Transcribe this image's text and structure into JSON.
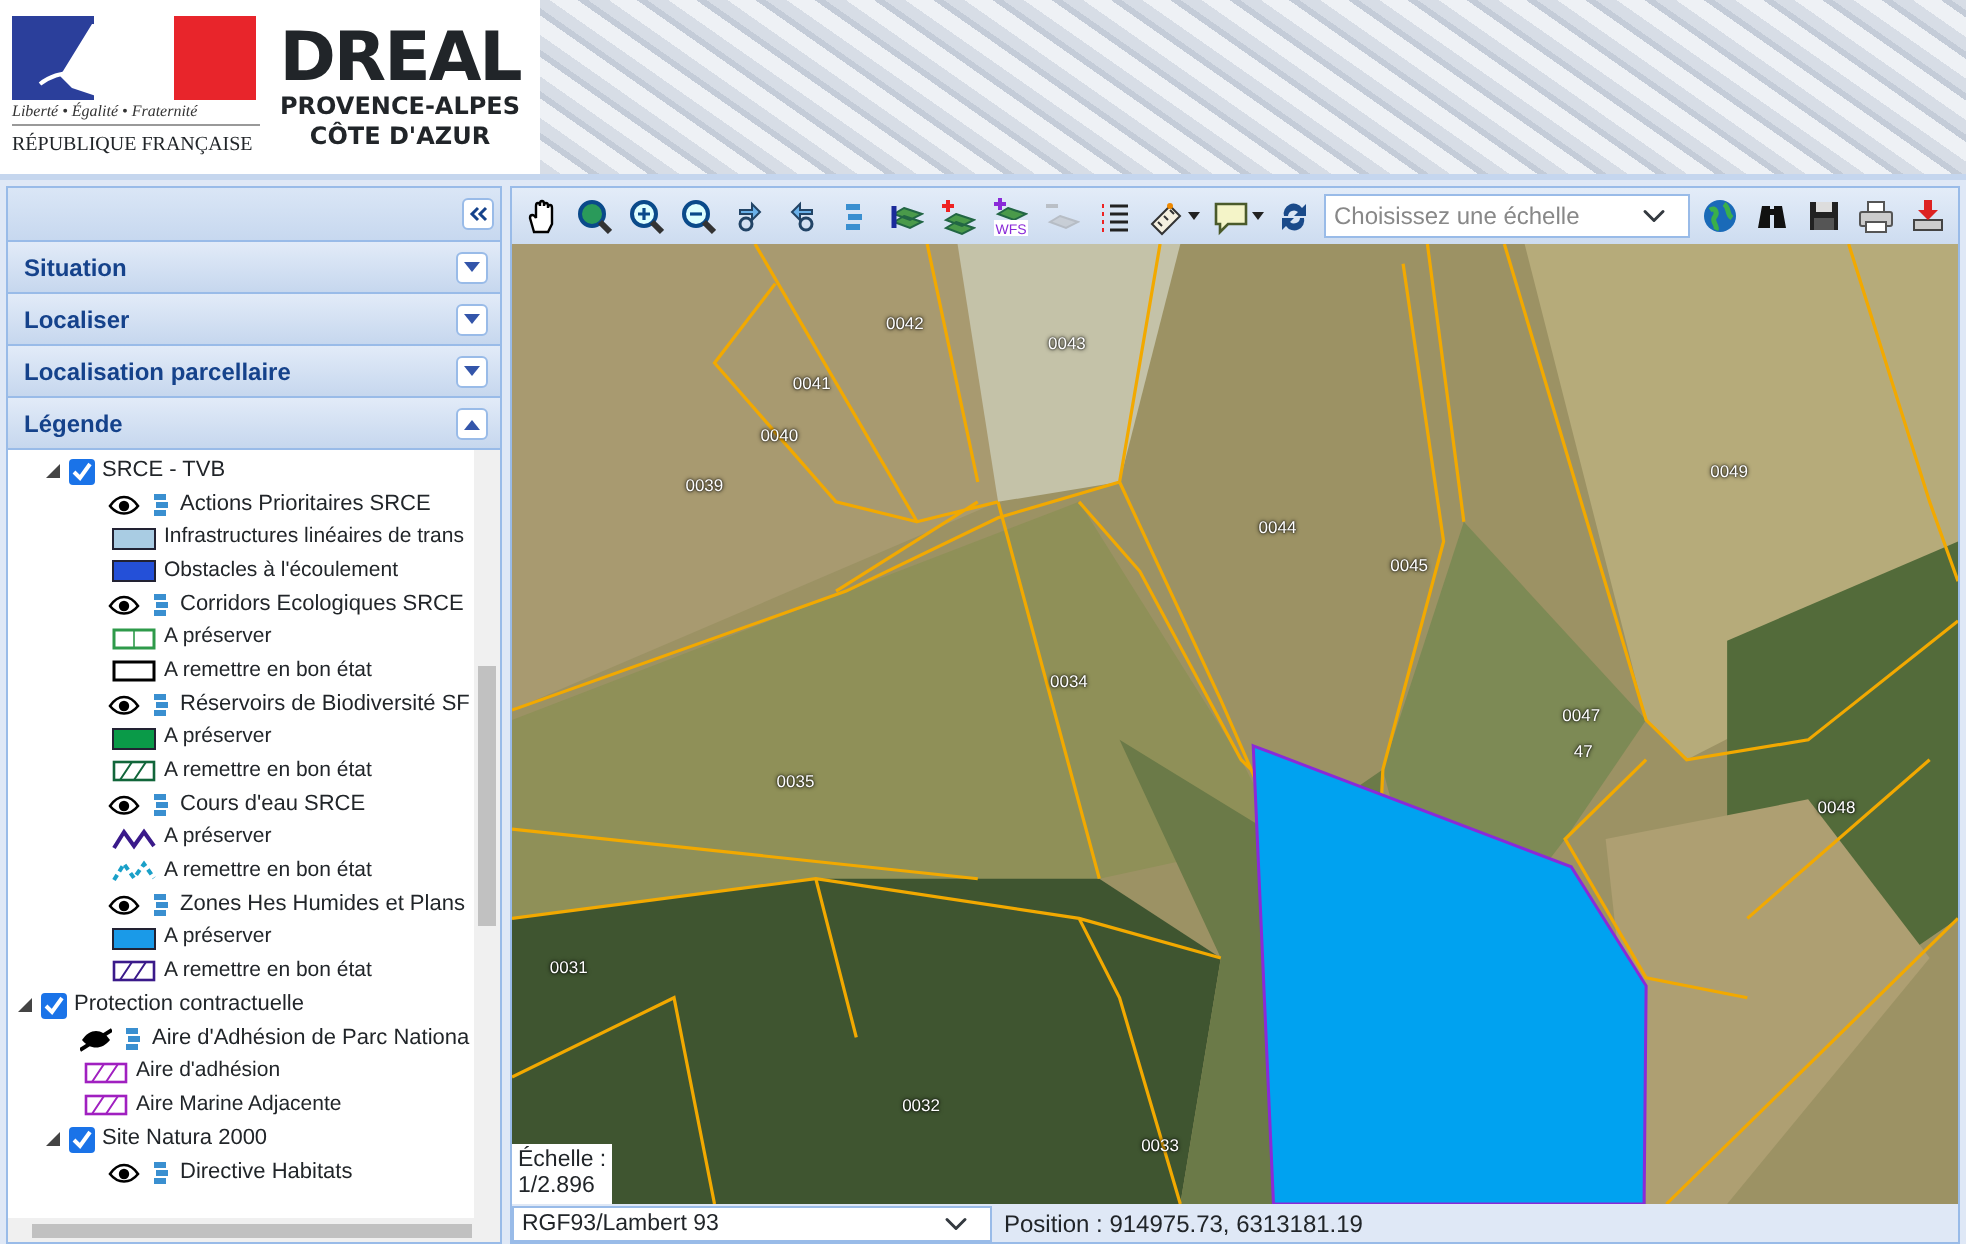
{
  "header": {
    "motto": "Liberté • Égalité • Fraternité",
    "republic": "RÉPUBLIQUE FRANÇAISE",
    "brand": "DREAL",
    "region_lines": [
      "PROVENCE-ALPES",
      "CÔTE D'AZUR"
    ]
  },
  "sidebar": {
    "panels": [
      {
        "title": "Situation",
        "expanded": false
      },
      {
        "title": "Localiser",
        "expanded": false
      },
      {
        "title": "Localisation parcellaire",
        "expanded": false
      },
      {
        "title": "Légende",
        "expanded": true
      }
    ],
    "legend_tree": {
      "children_of_scrolled_group": [
        {
          "kind": "group",
          "label": "SRCE - TVB",
          "checked": true,
          "expanded": true,
          "children": [
            {
              "kind": "layer",
              "label": "Actions Prioritaires SRCE",
              "visible": true,
              "legend": [
                {
                  "kind": "fill",
                  "color": "#a9cce3",
                  "label": "Infrastructures linéaires de trans"
                },
                {
                  "kind": "fill",
                  "color": "#2450d8",
                  "label": "Obstacles à l'écoulement"
                }
              ]
            },
            {
              "kind": "layer",
              "label": "Corridors Ecologiques SRCE",
              "visible": true,
              "legend": [
                {
                  "kind": "outline",
                  "color": "#2e9a4a",
                  "label": "A préserver"
                },
                {
                  "kind": "outline",
                  "color": "#000000",
                  "label": "A remettre en bon état"
                }
              ]
            },
            {
              "kind": "layer",
              "label": "Réservoirs de Biodiversité SF",
              "visible": true,
              "legend": [
                {
                  "kind": "fill",
                  "color": "#0a9a48",
                  "label": "A préserver"
                },
                {
                  "kind": "hatch",
                  "color": "#11663a",
                  "label": "A remettre en bon état"
                }
              ]
            },
            {
              "kind": "layer",
              "label": "Cours d'eau SRCE",
              "visible": true,
              "legend": [
                {
                  "kind": "line",
                  "color": "#3a1a8a",
                  "label": "A préserver"
                },
                {
                  "kind": "dashed-line",
                  "color": "#1aa0c8",
                  "label": "A remettre en bon état"
                }
              ]
            },
            {
              "kind": "layer",
              "label": "Zones Hes Humides et Plans",
              "visible": true,
              "legend": [
                {
                  "kind": "fill",
                  "color": "#1a9ae8",
                  "label": "A préserver"
                },
                {
                  "kind": "hatch",
                  "color": "#3a1a8a",
                  "label": "A remettre en bon état"
                }
              ]
            }
          ]
        }
      ],
      "items": [
        {
          "kind": "group",
          "label": "Protection contractuelle",
          "checked": true,
          "expanded": true,
          "children": [
            {
              "kind": "layer",
              "label": "Aire d'Adhésion de Parc Nationa",
              "visible": false,
              "legend": [
                {
                  "kind": "hatch",
                  "color": "#a020c0",
                  "label": "Aire d'adhésion"
                },
                {
                  "kind": "hatch",
                  "color": "#a020c0",
                  "label": "Aire Marine Adjacente"
                }
              ]
            },
            {
              "kind": "group",
              "label": "Site Natura 2000",
              "checked": true,
              "expanded": true,
              "children": [
                {
                  "kind": "layer",
                  "label": "Directive Habitats",
                  "visible": true
                }
              ]
            }
          ]
        }
      ]
    }
  },
  "toolbar": {
    "tools": [
      {
        "kind": "pan",
        "disabled": false
      },
      {
        "kind": "zoom-extent",
        "disabled": false
      },
      {
        "kind": "zoom-in",
        "disabled": false
      },
      {
        "kind": "zoom-out",
        "disabled": false
      },
      {
        "kind": "previous",
        "disabled": false
      },
      {
        "kind": "next",
        "disabled": false
      },
      {
        "kind": "layers",
        "disabled": false
      },
      {
        "kind": "layer-info",
        "disabled": false
      },
      {
        "kind": "add-layer",
        "disabled": false
      },
      {
        "kind": "add-wfs",
        "disabled": false,
        "label": "WFS"
      },
      {
        "kind": "remove-layer",
        "disabled": true
      },
      {
        "kind": "list",
        "disabled": false
      },
      {
        "kind": "measure",
        "disabled": false
      },
      {
        "kind": "comment",
        "disabled": false
      },
      {
        "kind": "refresh",
        "disabled": false
      }
    ],
    "scale_select": {
      "placeholder": "Choisissez une échelle"
    },
    "end_tools": [
      {
        "kind": "globe"
      },
      {
        "kind": "binoculars"
      },
      {
        "kind": "save"
      },
      {
        "kind": "print"
      },
      {
        "kind": "download"
      }
    ]
  },
  "map": {
    "parcel_labels": [
      "0042",
      "0043",
      "0041",
      "0040",
      "0039",
      "0044",
      "0045",
      "0049",
      "0034",
      "0035",
      "0047",
      "47",
      "0048",
      "0031",
      "0032",
      "0033"
    ],
    "scale_label": "Échelle :",
    "scale_value": "1/2.896"
  },
  "status_bar": {
    "projection": "RGF93/Lambert 93",
    "position": "Position : 914975.73, 6313181.19"
  }
}
